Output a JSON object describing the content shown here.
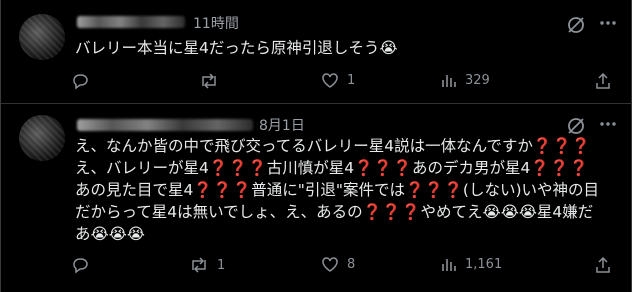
{
  "posts": [
    {
      "time": "11時間",
      "lines": [
        "バレリー本当に星4だったら原神引退しそう😭"
      ],
      "reply_count": "",
      "repost_count": "",
      "like_count": "1",
      "view_count": "329"
    },
    {
      "time": "8月1日",
      "lines": [
        "え、なんか皆の中で飛び交ってるバレリー星4説は一体なんですか❓❓❓",
        "え、バレリーが星4❓❓❓古川慎が星4❓❓❓あのデカ男が星4❓❓❓",
        "あの見た目で星4❓❓❓普通に\"引退\"案件では❓❓❓(しない)いや神の目",
        "だからって星4は無いでしょ、え、あるの❓❓❓やめてえ😭😭😭星4嫌だ",
        "あ😭😭😭"
      ],
      "reply_count": "",
      "repost_count": "1",
      "like_count": "8",
      "view_count": "1,161"
    }
  ],
  "icons": {
    "reply": "reply-icon",
    "repost": "repost-icon",
    "like": "heart-icon",
    "views": "views-icon",
    "share": "share-icon",
    "grok": "grok-icon",
    "more": "more-icon"
  },
  "colors": {
    "background": "#000000",
    "text": "#e7e9ea",
    "muted": "#9aa0a6",
    "accent_red": "#e8313b"
  }
}
